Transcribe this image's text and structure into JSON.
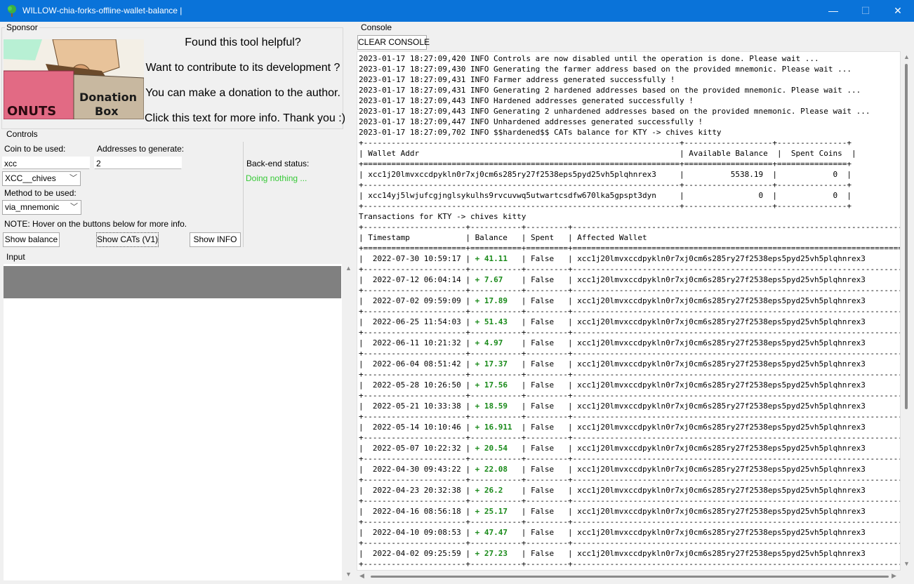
{
  "window": {
    "title": "WILLOW-chia-forks-offline-wallet-balance |",
    "minimize": "—",
    "maximize": "☐",
    "close": "✕"
  },
  "sponsor": {
    "label": "Sponsor",
    "image_text_1": "Donation",
    "image_text_2": "Box",
    "image_text_3": "ONUTS",
    "line1": "Found this tool helpful?",
    "line2": "Want to contribute to its development ?",
    "line3": "You can make a donation to the author.",
    "line4": "Click this text for more info. Thank you :)"
  },
  "controls": {
    "label": "Controls",
    "coin_label": "Coin to be used:",
    "coin_value": "xcc",
    "coin_select": "XCC__chives",
    "addresses_label": "Addresses to generate:",
    "addresses_value": "2",
    "method_label": "Method to be used:",
    "method_select": "via_mnemonic",
    "status_label": "Back-end status:",
    "status_value": "Doing nothing ...",
    "note": "NOTE: Hover on the buttons below for more info.",
    "btn_balance": "Show balance",
    "btn_cats": "Show CATs (V1)",
    "btn_info": "Show INFO"
  },
  "input": {
    "label": "Input"
  },
  "console": {
    "label": "Console",
    "clear_button": "CLEAR CONSOLE",
    "logs": [
      "2023-01-17 18:27:09,420 INFO Controls are now disabled until the operation is done. Please wait ...",
      "2023-01-17 18:27:09,430 INFO Generating the farmer address based on the provided mnemonic. Please wait ...",
      "2023-01-17 18:27:09,431 INFO Farmer address generated successfully !",
      "2023-01-17 18:27:09,431 INFO Generating 2 hardened addresses based on the provided mnemonic. Please wait ...",
      "2023-01-17 18:27:09,443 INFO Hardened addresses generated successfully !",
      "2023-01-17 18:27:09,443 INFO Generating 2 unhardened addresses based on the provided mnemonic. Please wait ...",
      "2023-01-17 18:27:09,447 INFO Unhardened addresses generated successfully !",
      "2023-01-17 18:27:09,702 INFO $$hardened$$ CATs balance for KTY -> chives kitty"
    ],
    "wallet_headers": [
      "Wallet Addr",
      "Available Balance",
      "Spent Coins"
    ],
    "wallets": [
      {
        "addr": "xcc1j20lmvxccdpykln0r7xj0cm6s285ry27f2538eps5pyd25vh5plqhnrex3",
        "balance": "5538.19",
        "spent": "0"
      },
      {
        "addr": "xcc14yj5lwjufcgjnglsykulhs9rvcuvwq5utwartcsdfw670lka5gpspt3dyn",
        "balance": "0",
        "spent": "0"
      }
    ],
    "transactions_title": "Transactions for KTY -> chives kitty",
    "tx_headers": [
      "Timestamp",
      "Balance",
      "Spent",
      "Affected Wallet"
    ],
    "transactions": [
      {
        "ts": "2022-07-30 10:59:17",
        "bal": "+ 41.11",
        "spent": "False",
        "wallet": "xcc1j20lmvxccdpykln0r7xj0cm6s285ry27f2538eps5pyd25vh5plqhnrex3"
      },
      {
        "ts": "2022-07-12 06:04:14",
        "bal": "+ 7.67",
        "spent": "False",
        "wallet": "xcc1j20lmvxccdpykln0r7xj0cm6s285ry27f2538eps5pyd25vh5plqhnrex3"
      },
      {
        "ts": "2022-07-02 09:59:09",
        "bal": "+ 17.89",
        "spent": "False",
        "wallet": "xcc1j20lmvxccdpykln0r7xj0cm6s285ry27f2538eps5pyd25vh5plqhnrex3"
      },
      {
        "ts": "2022-06-25 11:54:03",
        "bal": "+ 51.43",
        "spent": "False",
        "wallet": "xcc1j20lmvxccdpykln0r7xj0cm6s285ry27f2538eps5pyd25vh5plqhnrex3"
      },
      {
        "ts": "2022-06-11 10:21:32",
        "bal": "+ 4.97",
        "spent": "False",
        "wallet": "xcc1j20lmvxccdpykln0r7xj0cm6s285ry27f2538eps5pyd25vh5plqhnrex3"
      },
      {
        "ts": "2022-06-04 08:51:42",
        "bal": "+ 17.37",
        "spent": "False",
        "wallet": "xcc1j20lmvxccdpykln0r7xj0cm6s285ry27f2538eps5pyd25vh5plqhnrex3"
      },
      {
        "ts": "2022-05-28 10:26:50",
        "bal": "+ 17.56",
        "spent": "False",
        "wallet": "xcc1j20lmvxccdpykln0r7xj0cm6s285ry27f2538eps5pyd25vh5plqhnrex3"
      },
      {
        "ts": "2022-05-21 10:33:38",
        "bal": "+ 18.59",
        "spent": "False",
        "wallet": "xcc1j20lmvxccdpykln0r7xj0cm6s285ry27f2538eps5pyd25vh5plqhnrex3"
      },
      {
        "ts": "2022-05-14 10:10:46",
        "bal": "+ 16.911",
        "spent": "False",
        "wallet": "xcc1j20lmvxccdpykln0r7xj0cm6s285ry27f2538eps5pyd25vh5plqhnrex3"
      },
      {
        "ts": "2022-05-07 10:22:32",
        "bal": "+ 20.54",
        "spent": "False",
        "wallet": "xcc1j20lmvxccdpykln0r7xj0cm6s285ry27f2538eps5pyd25vh5plqhnrex3"
      },
      {
        "ts": "2022-04-30 09:43:22",
        "bal": "+ 22.08",
        "spent": "False",
        "wallet": "xcc1j20lmvxccdpykln0r7xj0cm6s285ry27f2538eps5pyd25vh5plqhnrex3"
      },
      {
        "ts": "2022-04-23 20:32:38",
        "bal": "+ 26.2",
        "spent": "False",
        "wallet": "xcc1j20lmvxccdpykln0r7xj0cm6s285ry27f2538eps5pyd25vh5plqhnrex3"
      },
      {
        "ts": "2022-04-16 08:56:18",
        "bal": "+ 25.17",
        "spent": "False",
        "wallet": "xcc1j20lmvxccdpykln0r7xj0cm6s285ry27f2538eps5pyd25vh5plqhnrex3"
      },
      {
        "ts": "2022-04-10 09:08:53",
        "bal": "+ 47.47",
        "spent": "False",
        "wallet": "xcc1j20lmvxccdpykln0r7xj0cm6s285ry27f2538eps5pyd25vh5plqhnrex3"
      },
      {
        "ts": "2022-04-02 09:25:59",
        "bal": "+ 27.23",
        "spent": "False",
        "wallet": "xcc1j20lmvxccdpykln0r7xj0cm6s285ry27f2538eps5pyd25vh5plqhnrex3"
      }
    ]
  }
}
